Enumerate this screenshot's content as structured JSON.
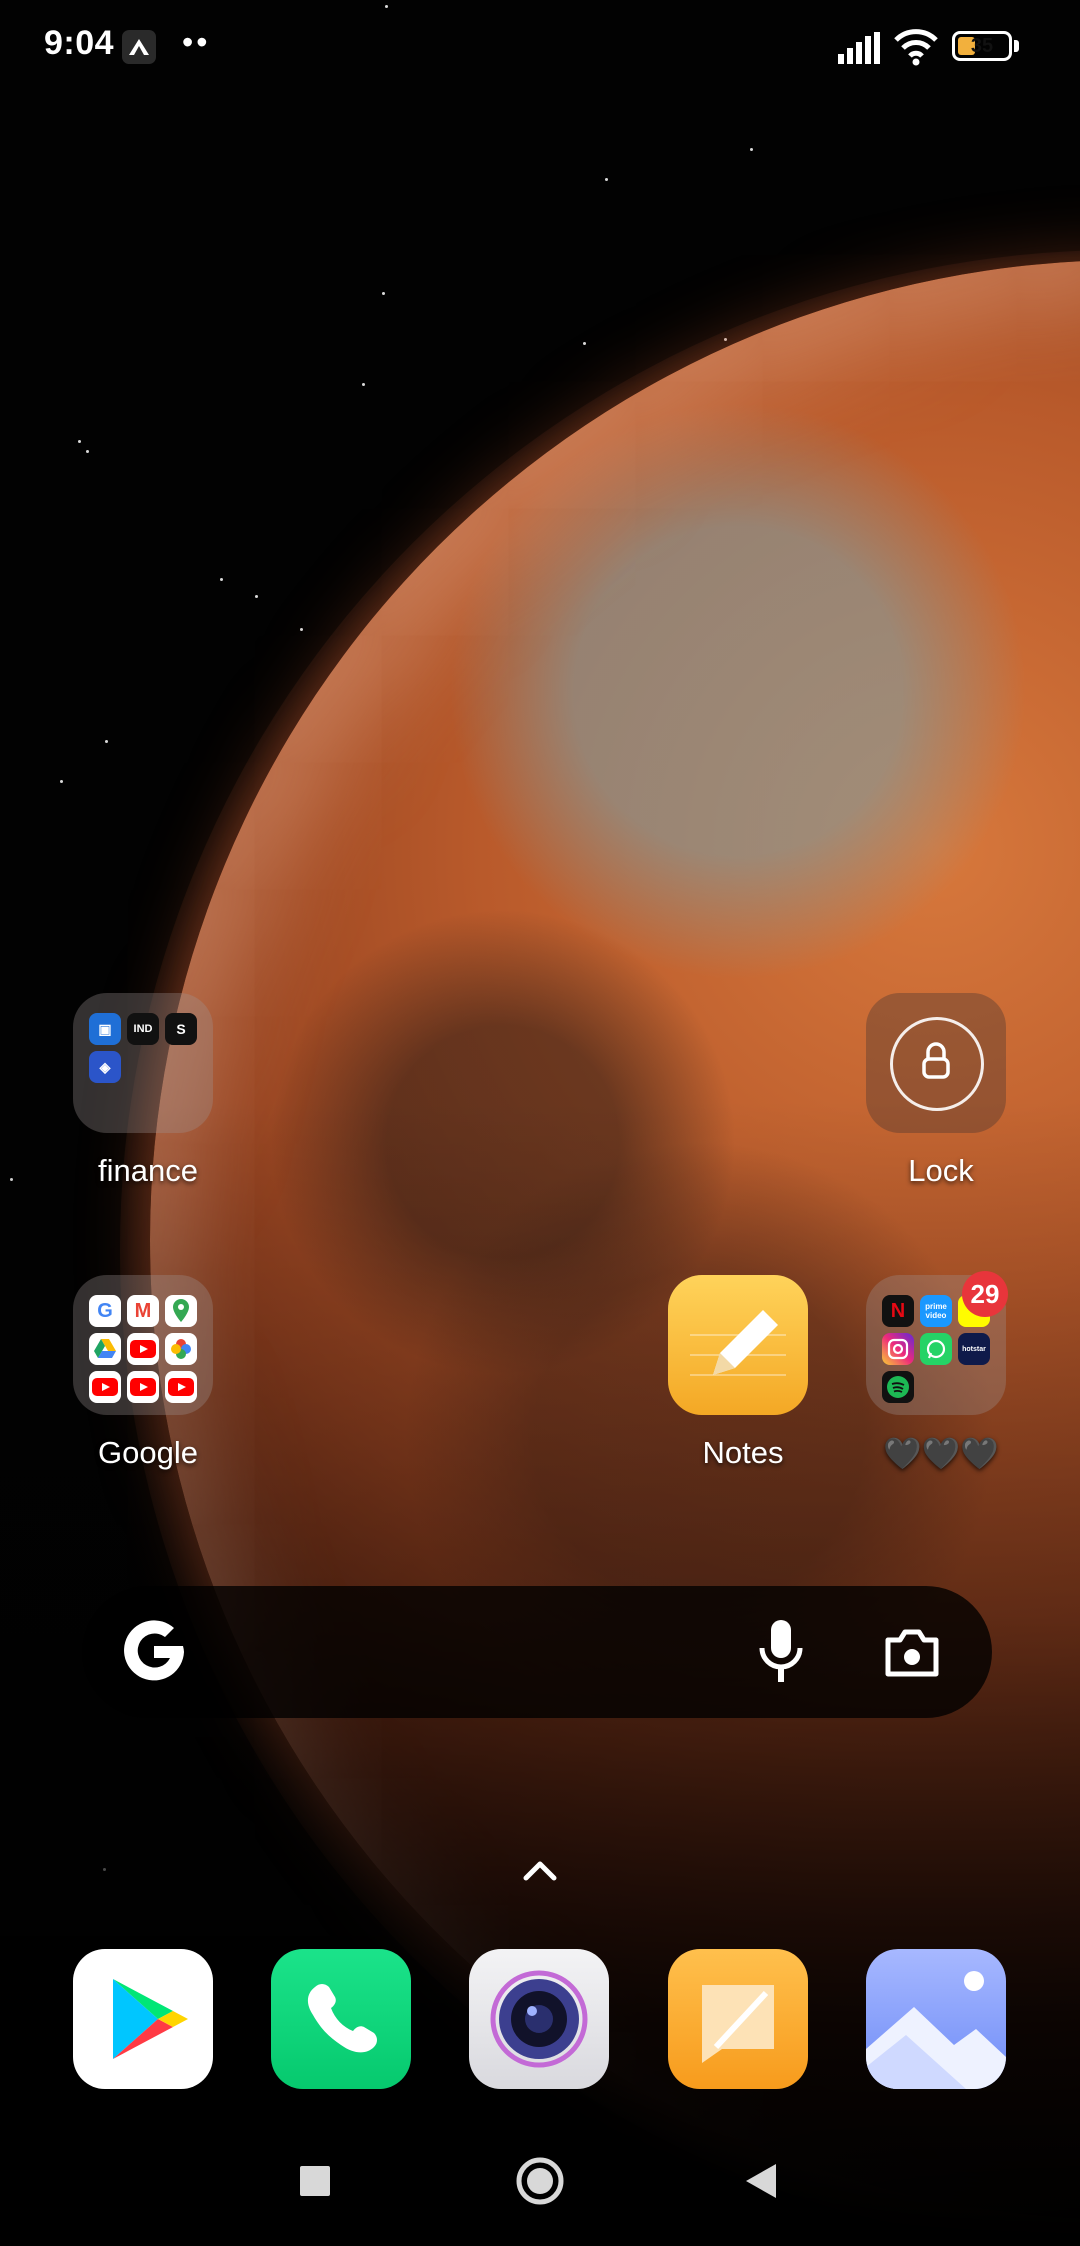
{
  "status_bar": {
    "time": "9:04",
    "battery": "35",
    "battery_percent": 35
  },
  "home": {
    "finance_folder": {
      "label": "finance",
      "mini_icons": [
        {
          "name": "blue-square-app-icon",
          "text": "",
          "color": "#1f6fd6"
        },
        {
          "name": "indmoney-icon",
          "text": "IND",
          "color": "#111111"
        },
        {
          "name": "s-app-icon",
          "text": "S",
          "color": "#111111"
        },
        {
          "name": "shield-app-icon",
          "text": "",
          "color": "#2b55c9"
        }
      ]
    },
    "lock": {
      "label": "Lock"
    },
    "google_folder": {
      "label": "Google",
      "mini_icons": [
        {
          "name": "google-icon",
          "text": "G",
          "color": "#ffffff"
        },
        {
          "name": "gmail-icon",
          "text": "M",
          "color": "#ffffff"
        },
        {
          "name": "maps-icon",
          "text": "",
          "color": "#ffffff"
        },
        {
          "name": "drive-icon",
          "text": "",
          "color": "#ffffff"
        },
        {
          "name": "youtube-icon",
          "text": "",
          "color": "#ffffff"
        },
        {
          "name": "photos-icon",
          "text": "",
          "color": "#ffffff"
        },
        {
          "name": "youtube-music-icon",
          "text": "",
          "color": "#ffffff"
        },
        {
          "name": "youtube-kids-icon",
          "text": "",
          "color": "#ffffff"
        },
        {
          "name": "youtube-studio-icon",
          "text": "",
          "color": "#ffffff"
        }
      ]
    },
    "notes": {
      "label": "Notes"
    },
    "entertainment_folder": {
      "label": "🖤🖤🖤",
      "badge": "29",
      "mini_icons": [
        {
          "name": "netflix-icon",
          "text": "N",
          "color": "#111111"
        },
        {
          "name": "prime-video-icon",
          "text": "prime video",
          "color": "#1a98ff"
        },
        {
          "name": "snapchat-icon",
          "text": "",
          "color": "#fffc00"
        },
        {
          "name": "instagram-icon",
          "text": "",
          "color": "#d6249f"
        },
        {
          "name": "whatsapp-icon",
          "text": "",
          "color": "#25d366"
        },
        {
          "name": "hotstar-icon",
          "text": "hotstar",
          "color": "#0f1a4a"
        },
        {
          "name": "spotify-icon",
          "text": "",
          "color": "#111111"
        }
      ]
    }
  },
  "search": {
    "google_logo": "G",
    "mic": "mic-icon",
    "lens": "camera-icon"
  },
  "dock": [
    {
      "name": "play-store-icon"
    },
    {
      "name": "phone-icon"
    },
    {
      "name": "camera-icon"
    },
    {
      "name": "messages-icon"
    },
    {
      "name": "gallery-icon"
    }
  ],
  "nav": [
    "recents-button",
    "home-button",
    "back-button"
  ]
}
